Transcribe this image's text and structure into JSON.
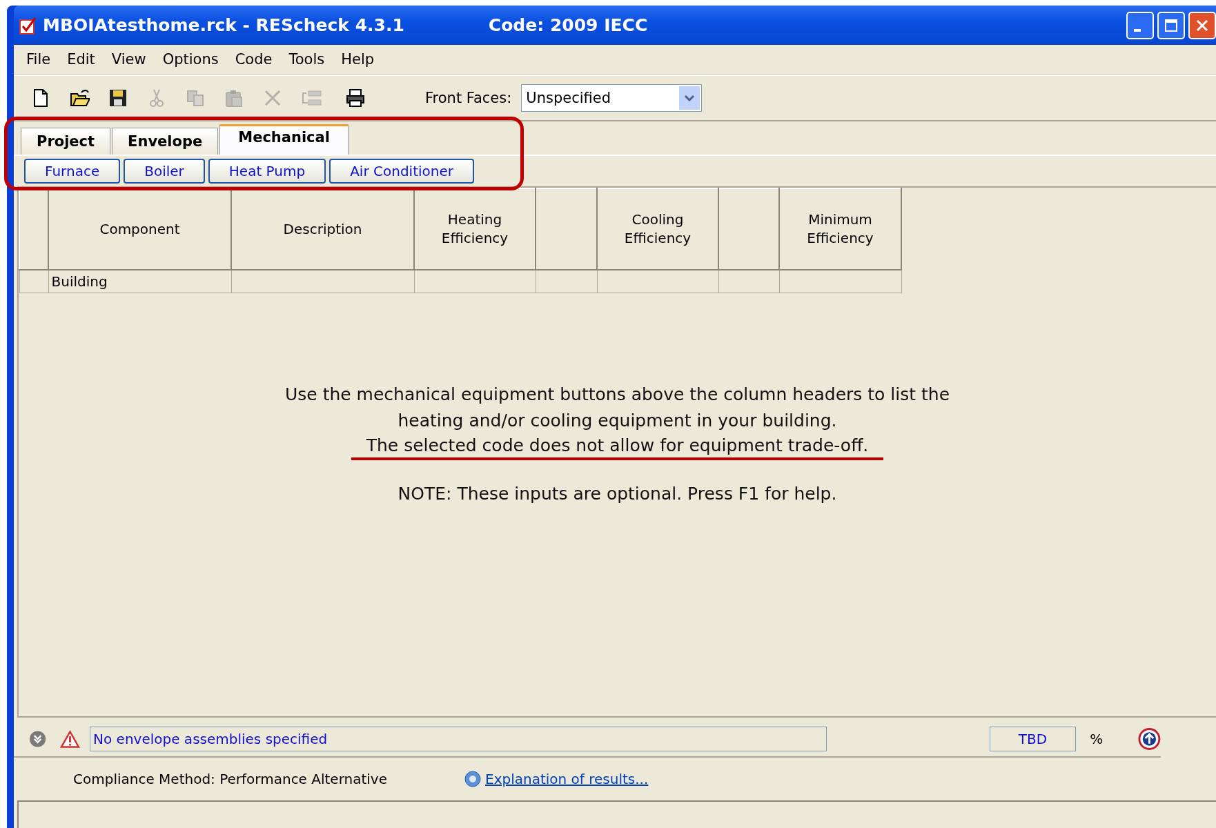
{
  "window": {
    "title": "MBOIAtesthome.rck - REScheck 4.3.1",
    "code": "Code: 2009 IECC"
  },
  "menu": [
    "File",
    "Edit",
    "View",
    "Options",
    "Code",
    "Tools",
    "Help"
  ],
  "toolbar": {
    "tools": [
      {
        "kind": "new",
        "disabled": false
      },
      {
        "kind": "open",
        "disabled": false
      },
      {
        "kind": "save",
        "disabled": false
      },
      {
        "kind": "cut",
        "disabled": true
      },
      {
        "kind": "copy",
        "disabled": true
      },
      {
        "kind": "paste",
        "disabled": true
      },
      {
        "kind": "delete",
        "disabled": true
      },
      {
        "kind": "insert",
        "disabled": true
      },
      {
        "kind": "print",
        "disabled": false
      }
    ],
    "front_faces_label": "Front Faces:",
    "front_faces_value": "Unspecified"
  },
  "tabs": [
    {
      "label": "Project",
      "selected": false
    },
    {
      "label": "Envelope",
      "selected": false
    },
    {
      "label": "Mechanical",
      "selected": true
    }
  ],
  "equipment_buttons": [
    "Furnace",
    "Boiler",
    "Heat Pump",
    "Air Conditioner"
  ],
  "table": {
    "columns": [
      {
        "kind": "blank"
      },
      {
        "kind": "text",
        "label": "Component"
      },
      {
        "kind": "text",
        "label": "Description"
      },
      {
        "kind": "text",
        "label": "Heating Efficiency"
      },
      {
        "kind": "blank"
      },
      {
        "kind": "text",
        "label": "Cooling Efficiency"
      },
      {
        "kind": "blank"
      },
      {
        "kind": "text",
        "label": "Minimum Efficiency"
      }
    ],
    "rows": [
      {
        "component": "Building"
      }
    ]
  },
  "message": {
    "lines": [
      {
        "text": "Use the mechanical equipment buttons above the column headers to list the",
        "underlined": false
      },
      {
        "text": "heating and/or cooling equipment in your building.",
        "underlined": false
      },
      {
        "text": "The selected code does not allow for equipment trade-off.",
        "underlined": true
      }
    ],
    "note": "NOTE:  These inputs are optional. Press F1 for help."
  },
  "annotations": [
    {
      "kind": "frame"
    }
  ],
  "status": {
    "message": "No envelope assemblies specified",
    "result": "TBD",
    "unit": "%",
    "compliance_method": "Compliance Method: Performance Alternative",
    "explanation_link": "Explanation of results..."
  }
}
